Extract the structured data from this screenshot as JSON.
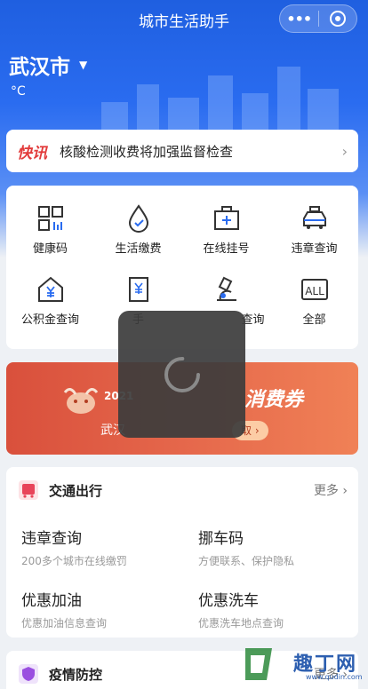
{
  "app": {
    "title": "城市生活助手"
  },
  "location": {
    "city": "武汉市",
    "temperature": "°C"
  },
  "news": {
    "tag": "快讯",
    "text": "核酸检测收费将加强监督检查"
  },
  "services": [
    {
      "label": "健康码",
      "icon": "qr-code-icon"
    },
    {
      "label": "生活缴费",
      "icon": "water-drop-icon"
    },
    {
      "label": "在线挂号",
      "icon": "medical-kit-icon"
    },
    {
      "label": "违章查询",
      "icon": "car-icon"
    },
    {
      "label": "公积金查询",
      "icon": "house-yen-icon"
    },
    {
      "label": "手",
      "icon": "book-icon"
    },
    {
      "label": "查询",
      "icon": "microscope-icon"
    },
    {
      "label": "全部",
      "icon": "all-icon"
    }
  ],
  "banner": {
    "year": "2021",
    "title_partial": "消费券",
    "sub_partial": "武汉",
    "button_partial": "取"
  },
  "traffic": {
    "title": "交通出行",
    "more": "更多",
    "items": [
      {
        "title": "违章查询",
        "sub": "200多个城市在线缴罚"
      },
      {
        "title": "挪车码",
        "sub": "方便联系、保护隐私"
      },
      {
        "title": "优惠加油",
        "sub": "优惠加油信息查询"
      },
      {
        "title": "优惠洗车",
        "sub": "优惠洗车地点查询"
      }
    ]
  },
  "epidemic": {
    "title": "疫情防控",
    "more": "更多"
  },
  "watermark": {
    "text": "趣丁网",
    "url": "www.qudin.com"
  },
  "colors": {
    "brand_blue": "#2a6cf0",
    "news_red": "#e23b3b",
    "banner_red": "#e5674b"
  }
}
